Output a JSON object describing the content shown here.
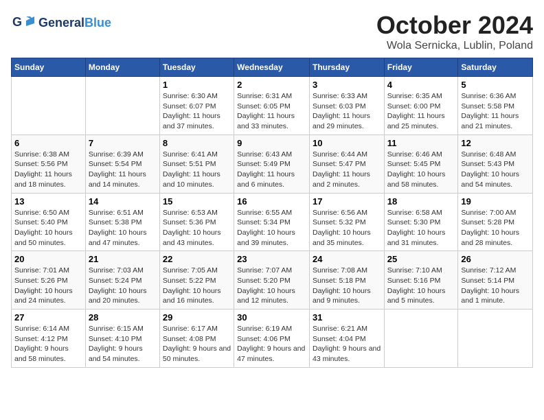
{
  "header": {
    "logo_line1": "General",
    "logo_line2": "Blue",
    "title": "October 2024",
    "subtitle": "Wola Sernicka, Lublin, Poland"
  },
  "weekdays": [
    "Sunday",
    "Monday",
    "Tuesday",
    "Wednesday",
    "Thursday",
    "Friday",
    "Saturday"
  ],
  "weeks": [
    [
      {
        "day": "",
        "detail": ""
      },
      {
        "day": "",
        "detail": ""
      },
      {
        "day": "1",
        "detail": "Sunrise: 6:30 AM\nSunset: 6:07 PM\nDaylight: 11 hours and 37 minutes."
      },
      {
        "day": "2",
        "detail": "Sunrise: 6:31 AM\nSunset: 6:05 PM\nDaylight: 11 hours and 33 minutes."
      },
      {
        "day": "3",
        "detail": "Sunrise: 6:33 AM\nSunset: 6:03 PM\nDaylight: 11 hours and 29 minutes."
      },
      {
        "day": "4",
        "detail": "Sunrise: 6:35 AM\nSunset: 6:00 PM\nDaylight: 11 hours and 25 minutes."
      },
      {
        "day": "5",
        "detail": "Sunrise: 6:36 AM\nSunset: 5:58 PM\nDaylight: 11 hours and 21 minutes."
      }
    ],
    [
      {
        "day": "6",
        "detail": "Sunrise: 6:38 AM\nSunset: 5:56 PM\nDaylight: 11 hours and 18 minutes."
      },
      {
        "day": "7",
        "detail": "Sunrise: 6:39 AM\nSunset: 5:54 PM\nDaylight: 11 hours and 14 minutes."
      },
      {
        "day": "8",
        "detail": "Sunrise: 6:41 AM\nSunset: 5:51 PM\nDaylight: 11 hours and 10 minutes."
      },
      {
        "day": "9",
        "detail": "Sunrise: 6:43 AM\nSunset: 5:49 PM\nDaylight: 11 hours and 6 minutes."
      },
      {
        "day": "10",
        "detail": "Sunrise: 6:44 AM\nSunset: 5:47 PM\nDaylight: 11 hours and 2 minutes."
      },
      {
        "day": "11",
        "detail": "Sunrise: 6:46 AM\nSunset: 5:45 PM\nDaylight: 10 hours and 58 minutes."
      },
      {
        "day": "12",
        "detail": "Sunrise: 6:48 AM\nSunset: 5:43 PM\nDaylight: 10 hours and 54 minutes."
      }
    ],
    [
      {
        "day": "13",
        "detail": "Sunrise: 6:50 AM\nSunset: 5:40 PM\nDaylight: 10 hours and 50 minutes."
      },
      {
        "day": "14",
        "detail": "Sunrise: 6:51 AM\nSunset: 5:38 PM\nDaylight: 10 hours and 47 minutes."
      },
      {
        "day": "15",
        "detail": "Sunrise: 6:53 AM\nSunset: 5:36 PM\nDaylight: 10 hours and 43 minutes."
      },
      {
        "day": "16",
        "detail": "Sunrise: 6:55 AM\nSunset: 5:34 PM\nDaylight: 10 hours and 39 minutes."
      },
      {
        "day": "17",
        "detail": "Sunrise: 6:56 AM\nSunset: 5:32 PM\nDaylight: 10 hours and 35 minutes."
      },
      {
        "day": "18",
        "detail": "Sunrise: 6:58 AM\nSunset: 5:30 PM\nDaylight: 10 hours and 31 minutes."
      },
      {
        "day": "19",
        "detail": "Sunrise: 7:00 AM\nSunset: 5:28 PM\nDaylight: 10 hours and 28 minutes."
      }
    ],
    [
      {
        "day": "20",
        "detail": "Sunrise: 7:01 AM\nSunset: 5:26 PM\nDaylight: 10 hours and 24 minutes."
      },
      {
        "day": "21",
        "detail": "Sunrise: 7:03 AM\nSunset: 5:24 PM\nDaylight: 10 hours and 20 minutes."
      },
      {
        "day": "22",
        "detail": "Sunrise: 7:05 AM\nSunset: 5:22 PM\nDaylight: 10 hours and 16 minutes."
      },
      {
        "day": "23",
        "detail": "Sunrise: 7:07 AM\nSunset: 5:20 PM\nDaylight: 10 hours and 12 minutes."
      },
      {
        "day": "24",
        "detail": "Sunrise: 7:08 AM\nSunset: 5:18 PM\nDaylight: 10 hours and 9 minutes."
      },
      {
        "day": "25",
        "detail": "Sunrise: 7:10 AM\nSunset: 5:16 PM\nDaylight: 10 hours and 5 minutes."
      },
      {
        "day": "26",
        "detail": "Sunrise: 7:12 AM\nSunset: 5:14 PM\nDaylight: 10 hours and 1 minute."
      }
    ],
    [
      {
        "day": "27",
        "detail": "Sunrise: 6:14 AM\nSunset: 4:12 PM\nDaylight: 9 hours and 58 minutes."
      },
      {
        "day": "28",
        "detail": "Sunrise: 6:15 AM\nSunset: 4:10 PM\nDaylight: 9 hours and 54 minutes."
      },
      {
        "day": "29",
        "detail": "Sunrise: 6:17 AM\nSunset: 4:08 PM\nDaylight: 9 hours and 50 minutes."
      },
      {
        "day": "30",
        "detail": "Sunrise: 6:19 AM\nSunset: 4:06 PM\nDaylight: 9 hours and 47 minutes."
      },
      {
        "day": "31",
        "detail": "Sunrise: 6:21 AM\nSunset: 4:04 PM\nDaylight: 9 hours and 43 minutes."
      },
      {
        "day": "",
        "detail": ""
      },
      {
        "day": "",
        "detail": ""
      }
    ]
  ]
}
